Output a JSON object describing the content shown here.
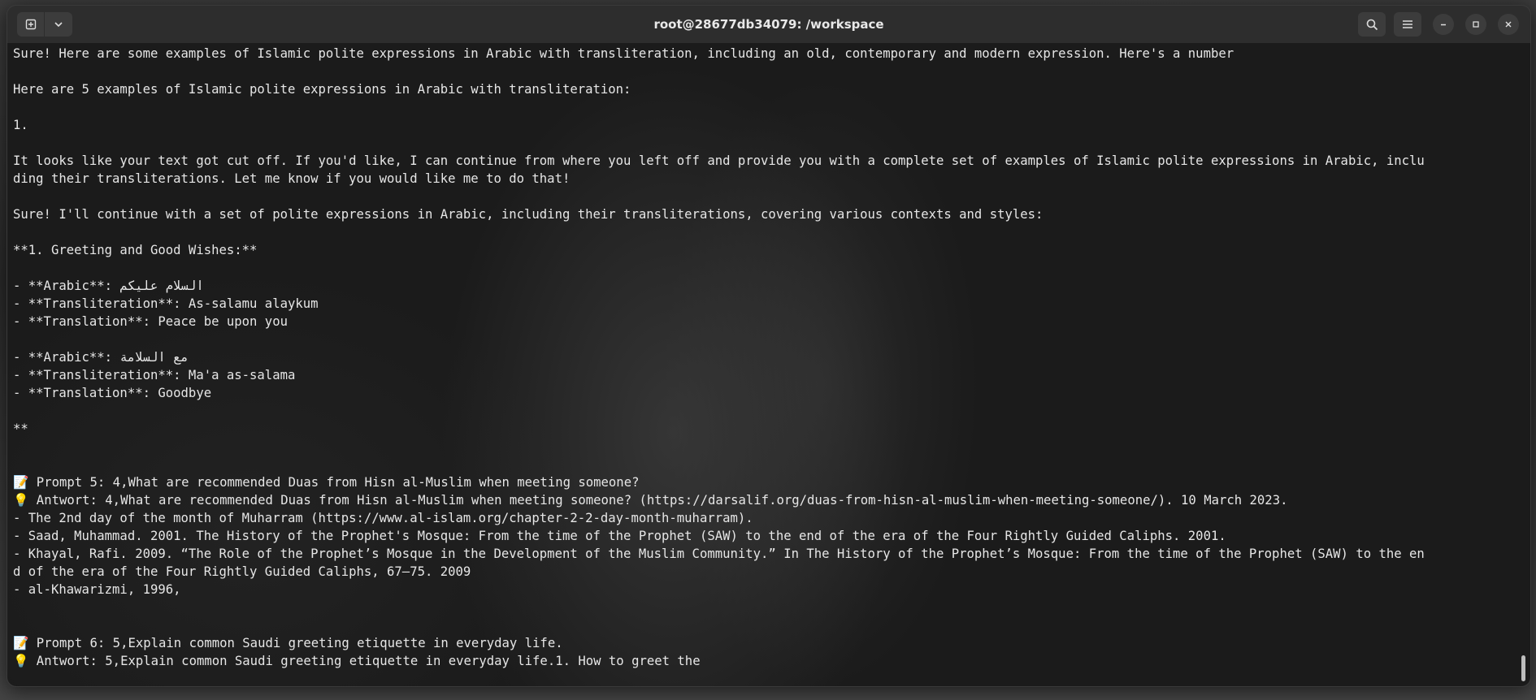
{
  "window": {
    "title": "root@28677db34079: /workspace"
  },
  "titlebar": {
    "new_tab_icon": "new-tab-icon",
    "dropdown_icon": "chevron-down-icon",
    "search_icon": "search-icon",
    "menu_icon": "hamburger-menu-icon",
    "minimize_icon": "minimize-icon",
    "maximize_icon": "maximize-icon",
    "close_icon": "close-icon"
  },
  "terminal": {
    "lines": [
      "Sure! Here are some examples of Islamic polite expressions in Arabic with transliteration, including an old, contemporary and modern expression. Here's a number",
      "",
      "Here are 5 examples of Islamic polite expressions in Arabic with transliteration:",
      "",
      "1.",
      "",
      "It looks like your text got cut off. If you'd like, I can continue from where you left off and provide you with a complete set of examples of Islamic polite expressions in Arabic, inclu",
      "ding their transliterations. Let me know if you would like me to do that!",
      "",
      "Sure! I'll continue with a set of polite expressions in Arabic, including their transliterations, covering various contexts and styles:",
      "",
      "**1. Greeting and Good Wishes:**",
      "",
      "- **Arabic**: السلام عليكم",
      "- **Transliteration**: As-salamu alaykum",
      "- **Translation**: Peace be upon you",
      "",
      "- **Arabic**: مع السلامة",
      "- **Transliteration**: Ma'a as-salama",
      "- **Translation**: Goodbye",
      "",
      "**",
      "",
      "",
      "📝 Prompt 5: 4,What are recommended Duas from Hisn al-Muslim when meeting someone?",
      "💡 Antwort: 4,What are recommended Duas from Hisn al-Muslim when meeting someone? (https://darsalif.org/duas-from-hisn-al-muslim-when-meeting-someone/). 10 March 2023.",
      "- The 2nd day of the month of Muharram (https://www.al-islam.org/chapter-2-2-day-month-muharram).",
      "- Saad, Muhammad. 2001. The History of the Prophet's Mosque: From the time of the Prophet (SAW) to the end of the era of the Four Rightly Guided Caliphs. 2001.",
      "- Khayal, Rafi. 2009. “The Role of the Prophet’s Mosque in the Development of the Muslim Community.” In The History of the Prophet’s Mosque: From the time of the Prophet (SAW) to the en",
      "d of the era of the Four Rightly Guided Caliphs, 67–75. 2009",
      "- al-Khawarizmi, 1996,",
      "",
      "",
      "📝 Prompt 6: 5,Explain common Saudi greeting etiquette in everyday life.",
      "💡 Antwort: 5,Explain common Saudi greeting etiquette in everyday life.1. How to greet the"
    ]
  }
}
